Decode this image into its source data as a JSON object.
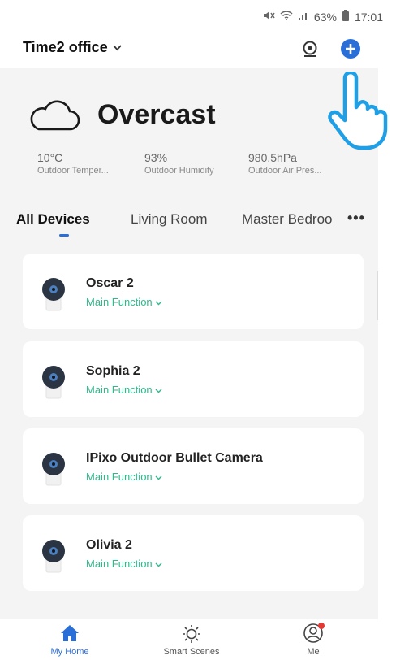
{
  "status_bar": {
    "battery": "63%",
    "time": "17:01",
    "icons": [
      "mute-icon",
      "wifi-icon",
      "signal-icon",
      "battery-icon"
    ]
  },
  "header": {
    "home_name": "Time2 office",
    "icons": [
      "camera-icon",
      "add-icon"
    ]
  },
  "weather": {
    "condition": "Overcast",
    "icon": "cloud-icon",
    "stats": [
      {
        "value": "10°C",
        "label": "Outdoor Temper..."
      },
      {
        "value": "93%",
        "label": "Outdoor Humidity"
      },
      {
        "value": "980.5hPa",
        "label": "Outdoor Air Pres..."
      }
    ]
  },
  "tabs": {
    "items": [
      "All Devices",
      "Living Room",
      "Master Bedroo"
    ],
    "active": "All Devices",
    "more": "•••"
  },
  "devices": [
    {
      "name": "Oscar 2",
      "function": "Main Function"
    },
    {
      "name": "Sophia 2",
      "function": "Main Function"
    },
    {
      "name": "IPixo Outdoor Bullet Camera",
      "function": "Main Function"
    },
    {
      "name": "Olivia 2",
      "function": "Main Function"
    }
  ],
  "bottom_nav": {
    "items": [
      {
        "label": "My Home",
        "icon": "home-icon",
        "active": true
      },
      {
        "label": "Smart Scenes",
        "icon": "sun-icon",
        "active": false
      },
      {
        "label": "Me",
        "icon": "profile-icon",
        "active": false
      }
    ]
  },
  "colors": {
    "accent": "#2a6ed8",
    "function_green": "#2fb98a",
    "hand_outline": "#1e9fe6",
    "background": "#f4f4f4"
  }
}
